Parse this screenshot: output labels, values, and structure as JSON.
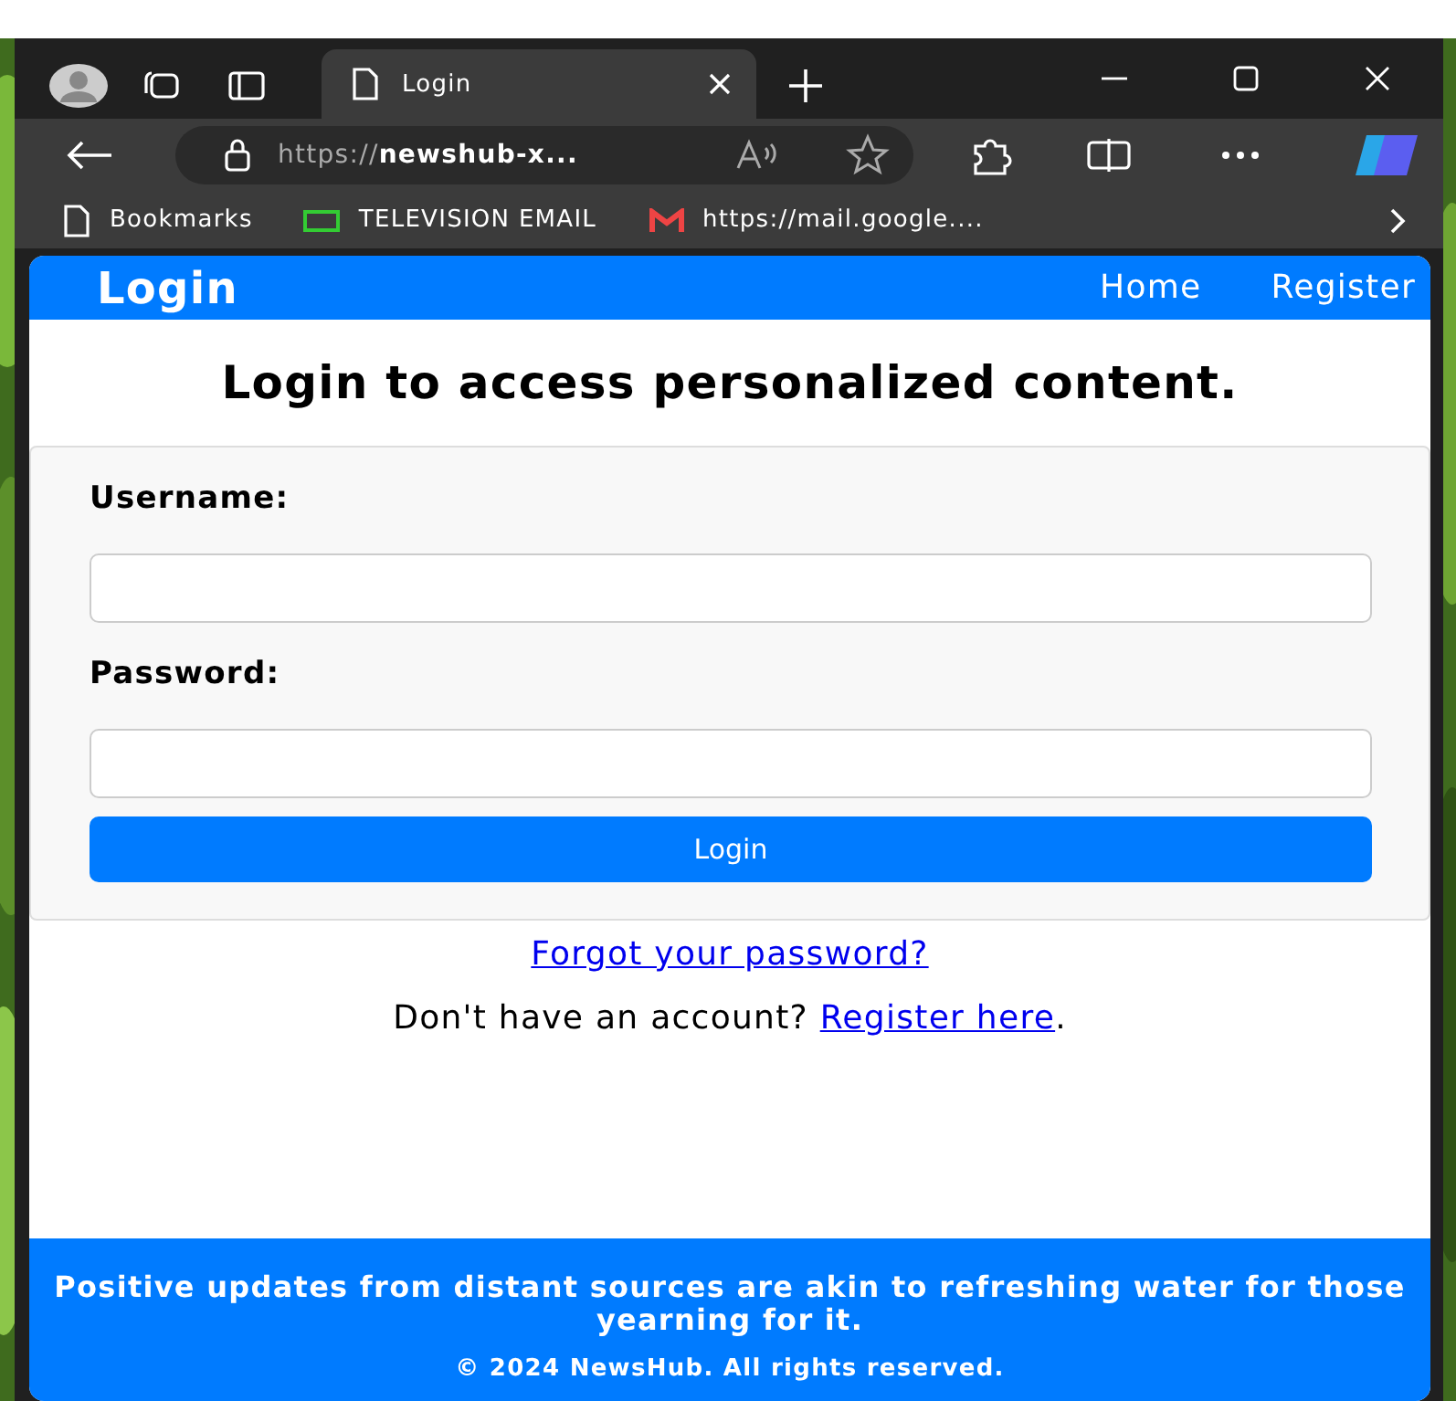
{
  "browser": {
    "tab_title": "Login",
    "url_prefix": "https://",
    "url_host": "newshub-x...",
    "bookmarks": [
      {
        "label": "Bookmarks",
        "kind": "folder"
      },
      {
        "label": "TELEVISION EMAIL",
        "kind": "site"
      },
      {
        "label": "https://mail.google....",
        "kind": "mail"
      }
    ]
  },
  "navbar": {
    "brand": "Login",
    "links": [
      "Home",
      "Register"
    ]
  },
  "heading": "Login to access personalized content.",
  "form": {
    "fields": [
      {
        "label": "Username:"
      },
      {
        "label": "Password:"
      }
    ],
    "submit": "Login"
  },
  "forgot_link": "Forgot your password?",
  "register_prompt": {
    "text": "Don't have an account?",
    "link": "Register here",
    "after": "."
  },
  "footer": {
    "quote": "Positive updates from distant sources are akin to refreshing water for those yearning for it.",
    "copyright": "© 2024 NewsHub. All rights reserved."
  }
}
